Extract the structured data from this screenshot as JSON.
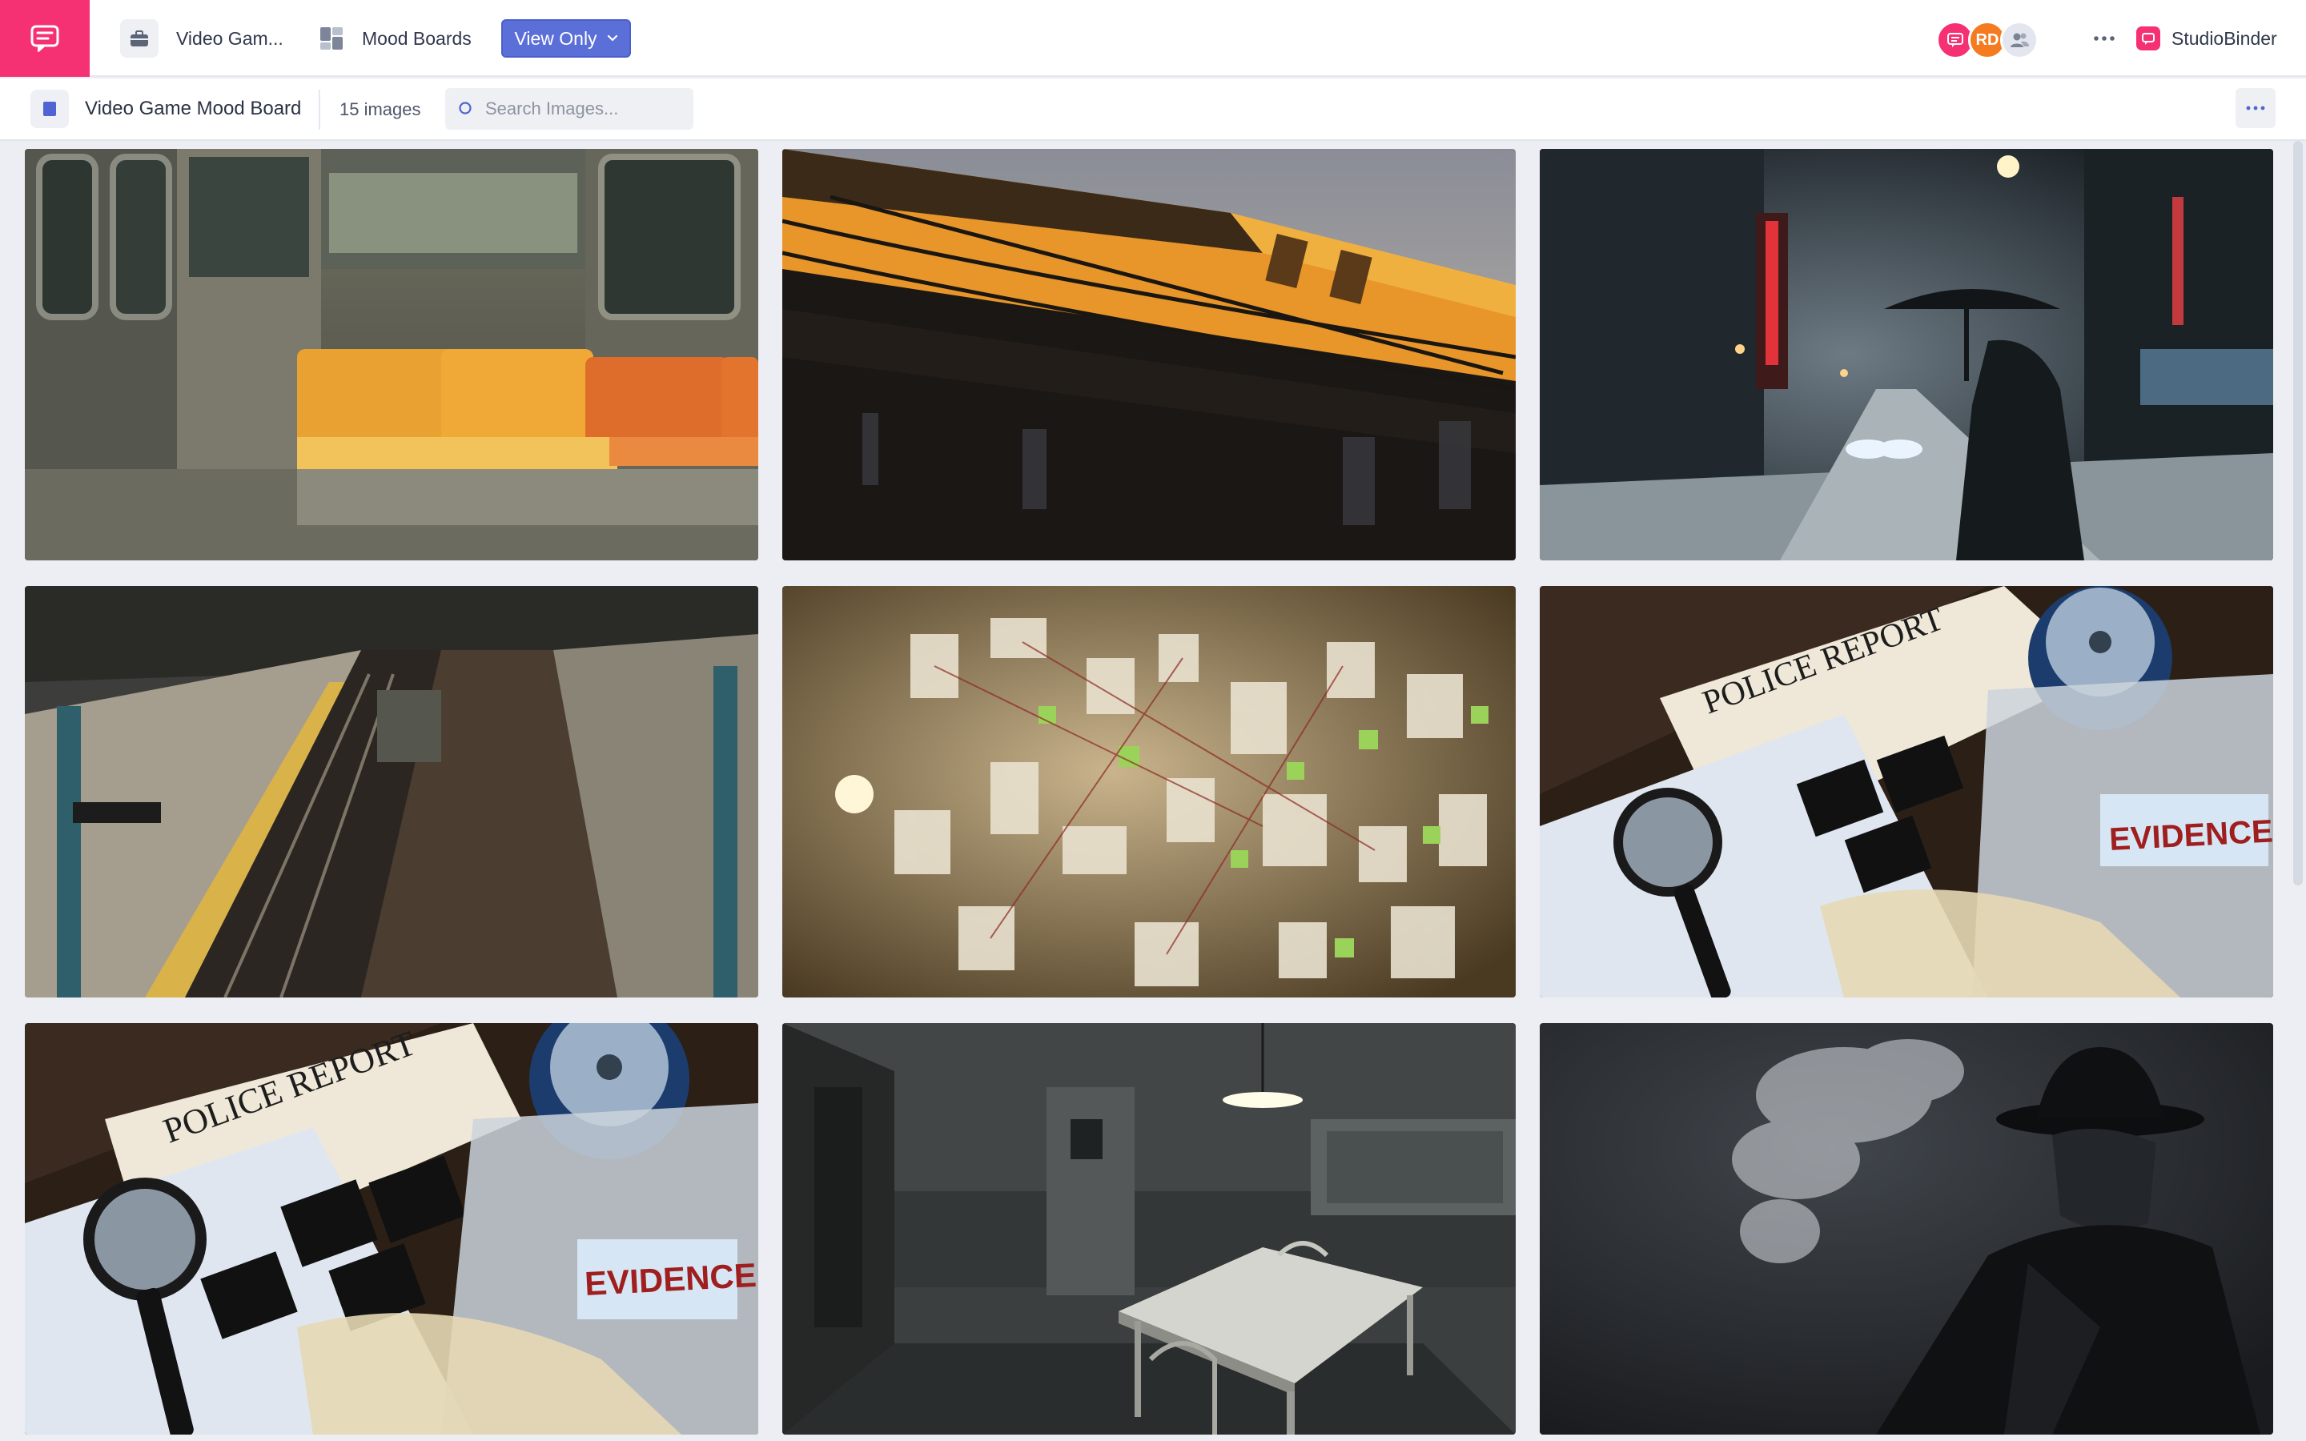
{
  "app": {
    "accent_color": "#f53173",
    "logo_icon": "chat-bubble-icon"
  },
  "header": {
    "project_label": "Video Gam...",
    "project_icon": "briefcase-icon",
    "section_label": "Mood Boards",
    "section_icon": "mood-board-icon",
    "view_only_label": "View Only",
    "avatars": [
      {
        "type": "icon",
        "icon": "chat-bubble-icon",
        "color": "#f53173"
      },
      {
        "type": "initials",
        "initials": "RD",
        "color": "#f47b20"
      },
      {
        "type": "icon",
        "icon": "users-icon",
        "color": "#e3e6ee"
      }
    ],
    "more_icon": "ellipsis-icon",
    "brand_label": "StudioBinder",
    "brand_icon": "studiobinder-logo-icon"
  },
  "toolbar": {
    "board_title": "Video Game Mood Board",
    "image_count": "15 images",
    "search_placeholder": "Search Images...",
    "search_icon": "search-icon",
    "more_icon": "ellipsis-icon"
  },
  "images": [
    {
      "subject": "subway-car-orange-seats-photo"
    },
    {
      "subject": "elevated-train-sunset-graffiti-photo"
    },
    {
      "subject": "radio-city-snowy-street-umbrella-photo"
    },
    {
      "subject": "subway-station-platform-photo"
    },
    {
      "subject": "investigation-board-clippings-photo"
    },
    {
      "subject": "police-report-evidence-photo"
    },
    {
      "subject": "police-report-evidence-close-photo"
    },
    {
      "subject": "interrogation-room-photo"
    },
    {
      "subject": "noir-detective-smoke-photo"
    }
  ]
}
